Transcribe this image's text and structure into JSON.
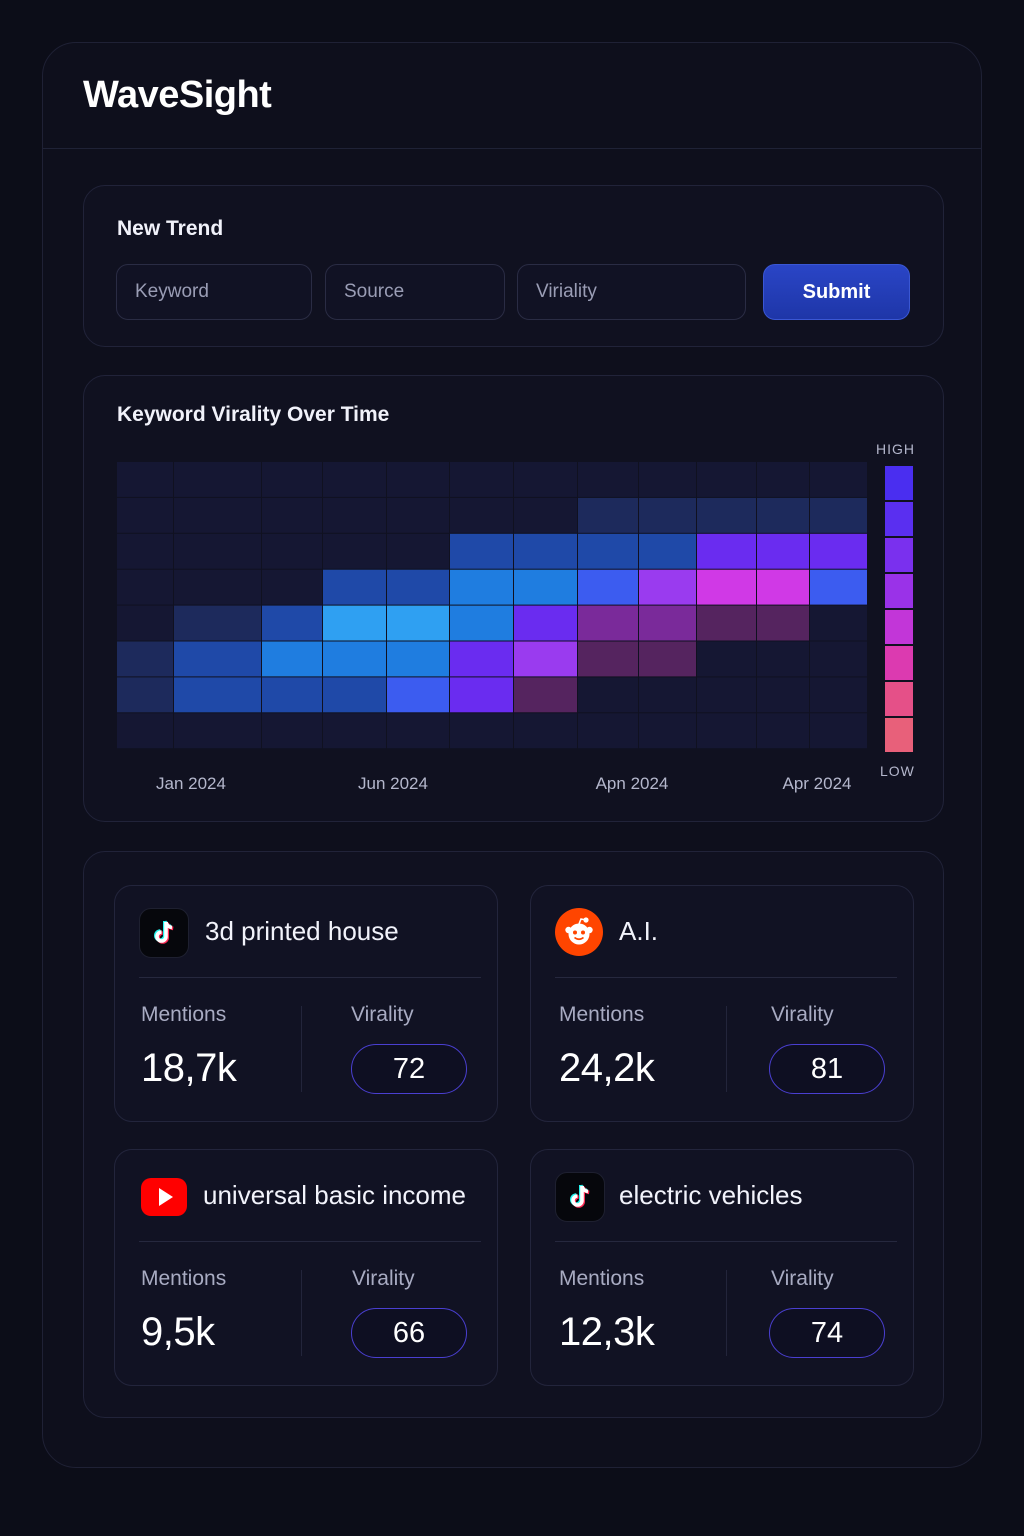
{
  "app": {
    "title": "WaveSight"
  },
  "new_trend": {
    "heading": "New Trend",
    "keyword_placeholder": "Keyword",
    "source_placeholder": "Source",
    "virality_placeholder": "Viriality",
    "submit_label": "Submit"
  },
  "chart": {
    "title": "Keyword Virality Over Time",
    "x_ticks": [
      "Jan 2024",
      "Jun 2024",
      "Apn 2024",
      "Apr 2024"
    ],
    "scale_high": "HIGH",
    "scale_low": "LOW"
  },
  "chart_data": {
    "type": "heatmap",
    "title": "Keyword Virality Over Time",
    "x_tick_labels": [
      "Jan 2024",
      "Jun 2024",
      "Apn 2024",
      "Apr 2024"
    ],
    "columns": 13,
    "rows": 8,
    "row_order": "top-to-bottom",
    "legend": {
      "high_label": "HIGH",
      "low_label": "LOW",
      "placement": "right"
    },
    "palette": [
      "#151733",
      "#1d2a5c",
      "#1f49a8",
      "#1f7de0",
      "#2fa0f2",
      "#3c5cf0",
      "#6a2cf0",
      "#9a3bef",
      "#d039e6",
      "#7a2a9a",
      "#55245f"
    ],
    "cells": [
      [
        0,
        0,
        0,
        0,
        0,
        0,
        0,
        0,
        0,
        0,
        0,
        0,
        0
      ],
      [
        0,
        0,
        0,
        0,
        0,
        0,
        0,
        1,
        1,
        1,
        1,
        1,
        0
      ],
      [
        0,
        0,
        0,
        0,
        0,
        2,
        2,
        2,
        2,
        6,
        6,
        6,
        0
      ],
      [
        0,
        0,
        0,
        2,
        2,
        3,
        3,
        5,
        7,
        8,
        8,
        5,
        0
      ],
      [
        0,
        1,
        2,
        4,
        4,
        3,
        6,
        9,
        9,
        10,
        10,
        0,
        0
      ],
      [
        1,
        2,
        3,
        3,
        3,
        6,
        7,
        10,
        10,
        0,
        0,
        0,
        0
      ],
      [
        1,
        2,
        2,
        2,
        5,
        6,
        10,
        0,
        0,
        0,
        0,
        0,
        0
      ],
      [
        0,
        0,
        0,
        0,
        0,
        0,
        0,
        0,
        0,
        0,
        0,
        0,
        0
      ]
    ],
    "legend_colors": [
      "#4a2ef0",
      "#5a2ff0",
      "#7a30ee",
      "#9a32e8",
      "#c236d8",
      "#dc3ab0",
      "#e55088",
      "#e8607a"
    ]
  },
  "trends": [
    {
      "source": "TikTok",
      "icon": "tiktok-icon",
      "keyword": "3d printed house",
      "mentions_label": "Mentions",
      "mentions": "18,7k",
      "virality_label": "Virality",
      "virality": "72"
    },
    {
      "source": "Reddit",
      "icon": "reddit-icon",
      "keyword": "A.I.",
      "mentions_label": "Mentions",
      "mentions": "24,2k",
      "virality_label": "Virality",
      "virality": "81"
    },
    {
      "source": "YouTube",
      "icon": "youtube-icon",
      "keyword": "universal basic income",
      "mentions_label": "Mentions",
      "mentions": "9,5k",
      "virality_label": "Virality",
      "virality": "66"
    },
    {
      "source": "TikTok",
      "icon": "tiktok-icon",
      "keyword": "electric vehicles",
      "mentions_label": "Mentions",
      "mentions": "12,3k",
      "virality_label": "Virality",
      "virality": "74"
    }
  ]
}
